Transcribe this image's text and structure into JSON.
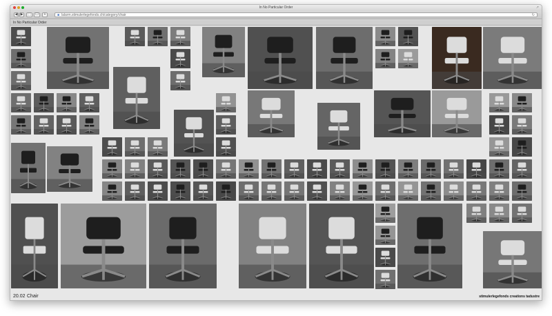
{
  "window": {
    "title": "In No Particular Order",
    "url": "lalarm.stimulerlegefonds.ch/category/chair"
  },
  "tab": {
    "title": "In No Particular Order"
  },
  "footer": {
    "time": "20.02",
    "label": "Chair",
    "credit": "stimulerlegefonds creations tadustre"
  },
  "colors": {
    "close": "#e0443e",
    "minimize": "#dea123",
    "maximize": "#1aab29",
    "page_background": "#e7e7e7"
  },
  "icons": [
    "back-icon",
    "forward-icon",
    "share-icon",
    "bookmark-icon",
    "lock-icon",
    "reload-icon",
    "resize-icon",
    "chair-photo"
  ]
}
